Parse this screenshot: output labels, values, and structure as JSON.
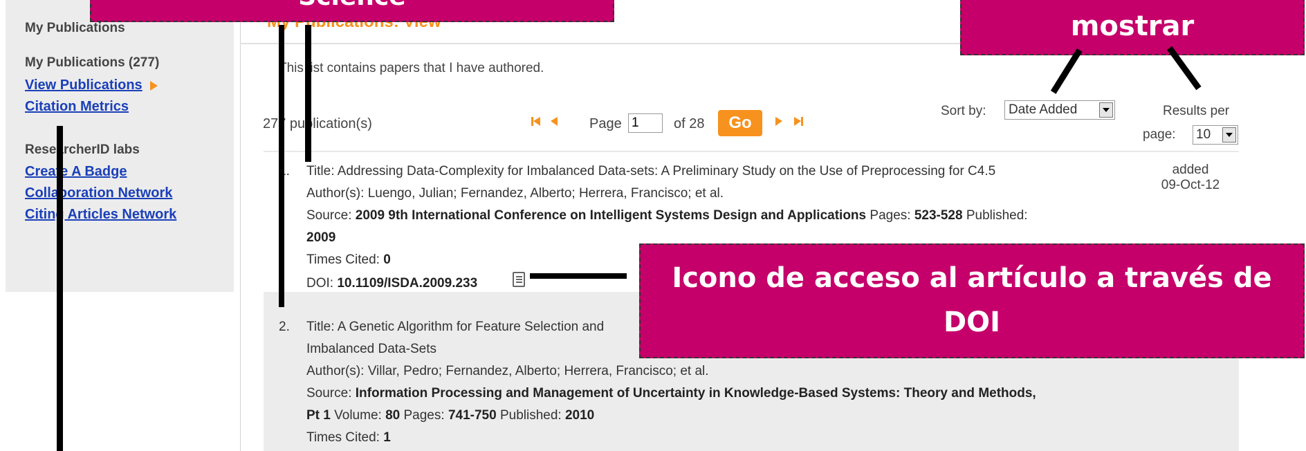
{
  "sidebar": {
    "heading": "My Publications",
    "count_heading": "My Publications (277)",
    "links": [
      "View Publications",
      "Citation Metrics"
    ],
    "labs_heading": "ResearcherID labs",
    "lab_links": [
      "Create A Badge",
      "Collaboration Network",
      "Citing Articles Network"
    ]
  },
  "main": {
    "title": "My Publications: View",
    "intro": "This list contains papers that I have authored.",
    "count": "277 publication(s)",
    "page_label": "Page",
    "page_value": "1",
    "of_label": "of 28",
    "go_label": "Go",
    "sort_label": "Sort by:",
    "sort_value": "Date Added",
    "results_label_1": "Results per",
    "results_label_2": "page:",
    "results_value": "10"
  },
  "entries": [
    {
      "number": "1.",
      "title": "Title: Addressing Data-Complexity for Imbalanced Data-sets: A Preliminary Study on the Use of Preprocessing for C4.5",
      "authors": "Author(s): Luengo, Julian; Fernandez, Alberto; Herrera, Francisco; et al.",
      "source_label": "Source:",
      "source": "2009 9th International Conference on Intelligent Systems Design and Applications",
      "pages_label": "Pages:",
      "pages": "523-528",
      "published_label": "Published:",
      "published": "2009",
      "cited_label": "Times Cited:",
      "cited": "0",
      "doi_label": "DOI:",
      "doi": "10.1109/ISDA.2009.233",
      "added_label": "added",
      "added_date": "09-Oct-12"
    },
    {
      "number": "2.",
      "title": "Title: A Genetic Algorithm for Feature Selection and",
      "title_cont": "Imbalanced Data-Sets",
      "authors": "Author(s): Villar, Pedro; Fernandez, Alberto; Herrera, Francisco; et al.",
      "source_label": "Source:",
      "source": "Information Processing and Management of Uncertainty in Knowledge-Based Systems: Theory and Methods,",
      "source_cont": "Pt 1",
      "volume_label": "Volume:",
      "volume": "80",
      "pages_label": "Pages:",
      "pages": "741-750",
      "published_label": "Published:",
      "published": "2010",
      "cited_label": "Times Cited:",
      "cited": "1"
    }
  ],
  "annotations": {
    "top_left": "Science",
    "top_right": "mostrar",
    "doi_callout_1": "Icono de acceso al artículo a través de",
    "doi_callout_2": "DOI"
  },
  "colors": {
    "accent": "#f7921e",
    "callout": "#c5006a",
    "link": "#1a3fb8"
  }
}
